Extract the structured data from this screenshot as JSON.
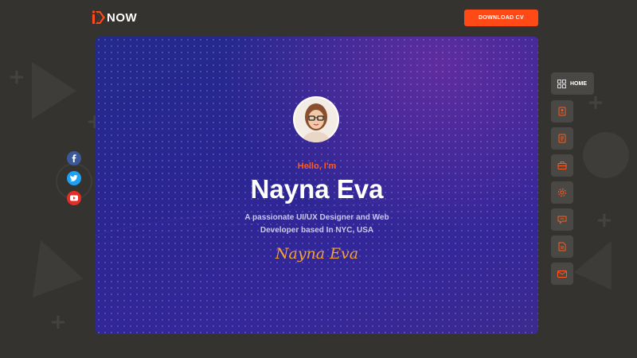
{
  "header": {
    "logo_text": "NOW",
    "download_label": "DOWNLOAD CV"
  },
  "hero": {
    "greeting": "Hello, I'm",
    "name": "Nayna Eva",
    "description": "A passionate UI/UX Designer and Web Developer based In NYC, USA",
    "signature": "Nayna Eva"
  },
  "nav": {
    "home_label": "HOME",
    "items": [
      "grid-icon",
      "profile-icon",
      "resume-icon",
      "portfolio-icon",
      "services-icon",
      "testimonial-icon",
      "blog-icon",
      "contact-icon"
    ]
  },
  "social": [
    "facebook-icon",
    "twitter-icon",
    "youtube-icon"
  ],
  "colors": {
    "accent": "#ff4a17",
    "background": "#35332f",
    "hero": "#2b2692",
    "signature": "#f2a23c"
  }
}
